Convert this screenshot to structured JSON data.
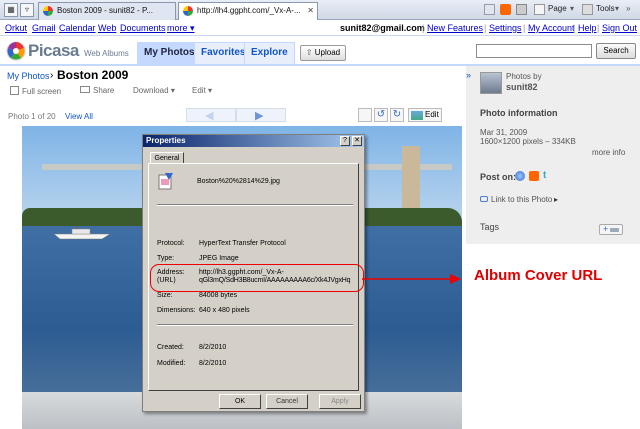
{
  "browser": {
    "tabs": [
      {
        "label": "Boston 2009 - sunit82 - P..."
      },
      {
        "label": "http://lh4.ggpht.com/_Vx-A-..."
      }
    ],
    "toolbar": {
      "page_label": "Page",
      "tools_label": "Tools"
    }
  },
  "gbar": {
    "left_links": [
      "Orkut",
      "Gmail",
      "Calendar",
      "Web",
      "Documents",
      "more ▾"
    ],
    "email": "sunit82@gmail.com",
    "right_links": [
      "New Features",
      "Settings",
      "My Account",
      "Help",
      "Sign Out"
    ]
  },
  "header": {
    "logo_text": "Picasa",
    "logo_sub": "Web Albums",
    "tabs": [
      "My Photos",
      "Favorites",
      "Explore"
    ],
    "upload_label": "Upload",
    "search_value": "",
    "search_button": "Search"
  },
  "album": {
    "breadcrumb_parent": "My Photos",
    "separator": "›",
    "title": "Boston 2009",
    "actions": [
      "Full screen",
      "Share",
      "Download",
      "Edit"
    ],
    "photo_counter": "Photo 1 of 20",
    "view_all": "View All",
    "edit_label": "Edit"
  },
  "dialog": {
    "title": "Properties",
    "tab": "General",
    "filename": "Boston%20%2814%29.jpg",
    "rows": [
      {
        "label": "Protocol:",
        "value": "HyperText Transfer Protocol"
      },
      {
        "label": "Type:",
        "value": "JPEG Image"
      },
      {
        "label": "Address:",
        "label2": "(URL)",
        "value": "http://lh3.ggpht.com/_Vx-A-",
        "value2": "qGl3mQ/SdH3B8ucmI/AAAAAAAAA6c/Xk4JVgxHq"
      },
      {
        "label": "Size:",
        "value": "84008 bytes"
      },
      {
        "label": "Dimensions:",
        "value": "640  x  480  pixels"
      },
      {
        "label": "Created:",
        "value": "8/2/2010"
      },
      {
        "label": "Modified:",
        "value": "8/2/2010"
      }
    ],
    "buttons": [
      "OK",
      "Cancel",
      "Apply"
    ]
  },
  "annotation": {
    "callout": "Album Cover URL",
    "color": "#e00000"
  },
  "sidebar": {
    "collapse_glyph": "»",
    "photos_by": "Photos by",
    "owner": "sunit82",
    "info_heading": "Photo information",
    "date": "Mar 31, 2009",
    "dimensions": "1600×1200 pixels – 334KB",
    "more_info": "more info",
    "post_on": "Post on:",
    "link_to_photo": "Link to this Photo",
    "tags_heading": "Tags"
  },
  "colors": {
    "accent": "#15c",
    "tab_bg": "#c3d9ff"
  }
}
